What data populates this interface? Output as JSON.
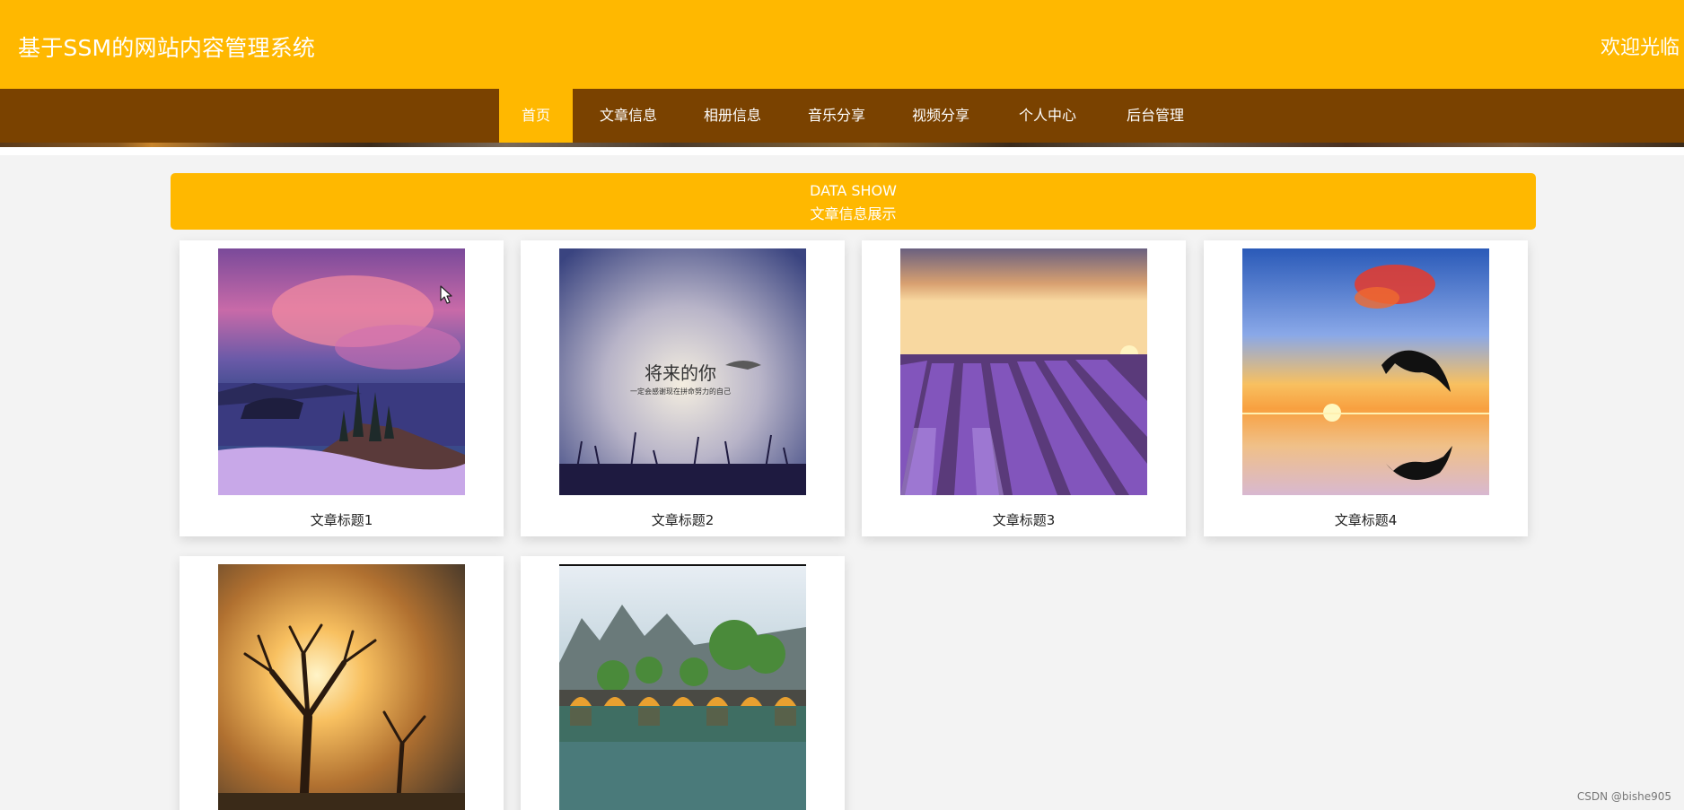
{
  "header": {
    "site_title": "基于SSM的网站内容管理系统",
    "welcome": "欢迎光临"
  },
  "nav": {
    "items": [
      {
        "label": "首页",
        "active": true
      },
      {
        "label": "文章信息",
        "active": false
      },
      {
        "label": "相册信息",
        "active": false
      },
      {
        "label": "音乐分享",
        "active": false
      },
      {
        "label": "视频分享",
        "active": false
      },
      {
        "label": "个人中心",
        "active": false
      },
      {
        "label": "后台管理",
        "active": false
      }
    ]
  },
  "section": {
    "title_en": "DATA SHOW",
    "title_cn": "文章信息展示"
  },
  "articles": [
    {
      "title": "文章标题1",
      "image": "mountain-lake-sunset"
    },
    {
      "title": "文章标题2",
      "image": "sky-poem-grass",
      "image_text": "将来的你",
      "image_subtext": "一定会感谢现在拼命努力的自己"
    },
    {
      "title": "文章标题3",
      "image": "lavender-field"
    },
    {
      "title": "文章标题4",
      "image": "dolphin-sunset"
    },
    {
      "title": "",
      "image": "tree-sunrise"
    },
    {
      "title": "",
      "image": "stone-bridge-river"
    }
  ],
  "colors": {
    "accent": "#ffb800",
    "nav_bg": "#7a4200",
    "page_bg": "#f3f3f3"
  },
  "watermark": "CSDN @bishe905"
}
